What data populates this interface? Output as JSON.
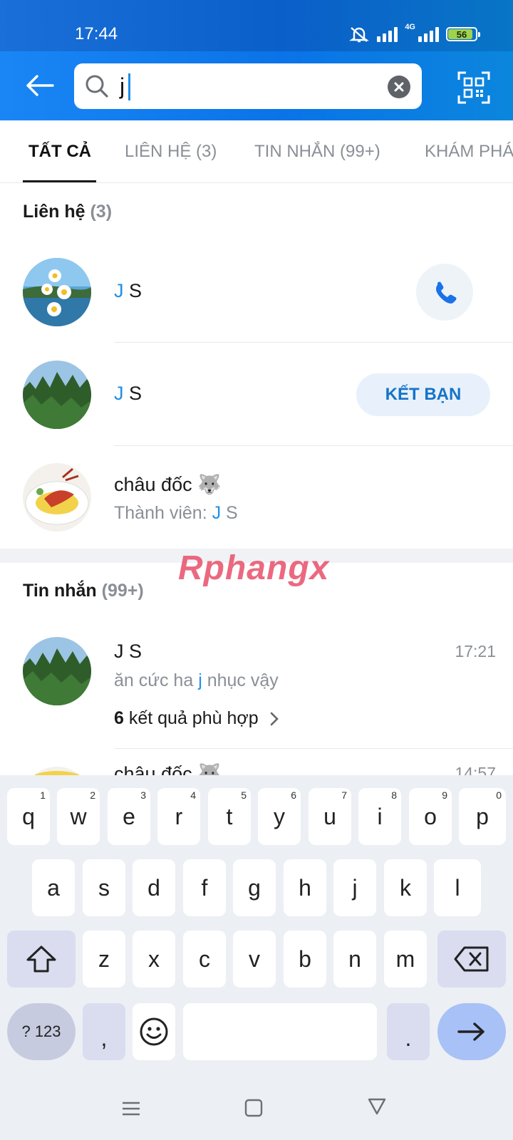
{
  "status_bar": {
    "time": "17:44",
    "network": "4G",
    "battery": "56"
  },
  "search": {
    "query": "j"
  },
  "tabs": [
    {
      "label": "TẤT CẢ"
    },
    {
      "label": "LIÊN HỆ (3)"
    },
    {
      "label": "TIN NHẮN (99+)"
    },
    {
      "label": "KHÁM PHÁ"
    }
  ],
  "contacts_section": {
    "title": "Liên hệ",
    "count": "(3)"
  },
  "contacts": [
    {
      "name_hl": "J",
      "name_rest": " S",
      "action": "call-icon"
    },
    {
      "name_hl": "J",
      "name_rest": " S",
      "action_label": "KẾT BẠN"
    },
    {
      "name": "châu đốc 🐺",
      "member_prefix": "Thành viên: ",
      "member_hl": "J",
      "member_rest": " S"
    }
  ],
  "watermark": "Rphangx",
  "messages_section": {
    "title": "Tin nhắn",
    "count": "(99+)"
  },
  "messages": [
    {
      "name": "J S",
      "time": "17:21",
      "preview_before": "ăn cức ha ",
      "preview_hl": "j",
      "preview_after": " nhục vậy",
      "results_count": "6",
      "results_label": "kết quả phù hợp"
    },
    {
      "name": "châu đốc 🐺",
      "time": "14:57"
    }
  ],
  "keyboard": {
    "row1": [
      [
        "q",
        "1"
      ],
      [
        "w",
        "2"
      ],
      [
        "e",
        "3"
      ],
      [
        "r",
        "4"
      ],
      [
        "t",
        "5"
      ],
      [
        "y",
        "6"
      ],
      [
        "u",
        "7"
      ],
      [
        "i",
        "8"
      ],
      [
        "o",
        "9"
      ],
      [
        "p",
        "0"
      ]
    ],
    "row2": [
      "a",
      "s",
      "d",
      "f",
      "g",
      "h",
      "j",
      "k",
      "l"
    ],
    "row3": [
      "z",
      "x",
      "c",
      "v",
      "b",
      "n",
      "m"
    ],
    "symbols_label": "? 123",
    "comma": ",",
    "period": "."
  },
  "colors": {
    "header": "#0a73e8",
    "accent": "#1f8fe6",
    "keyboard_bg": "#eceff4"
  }
}
